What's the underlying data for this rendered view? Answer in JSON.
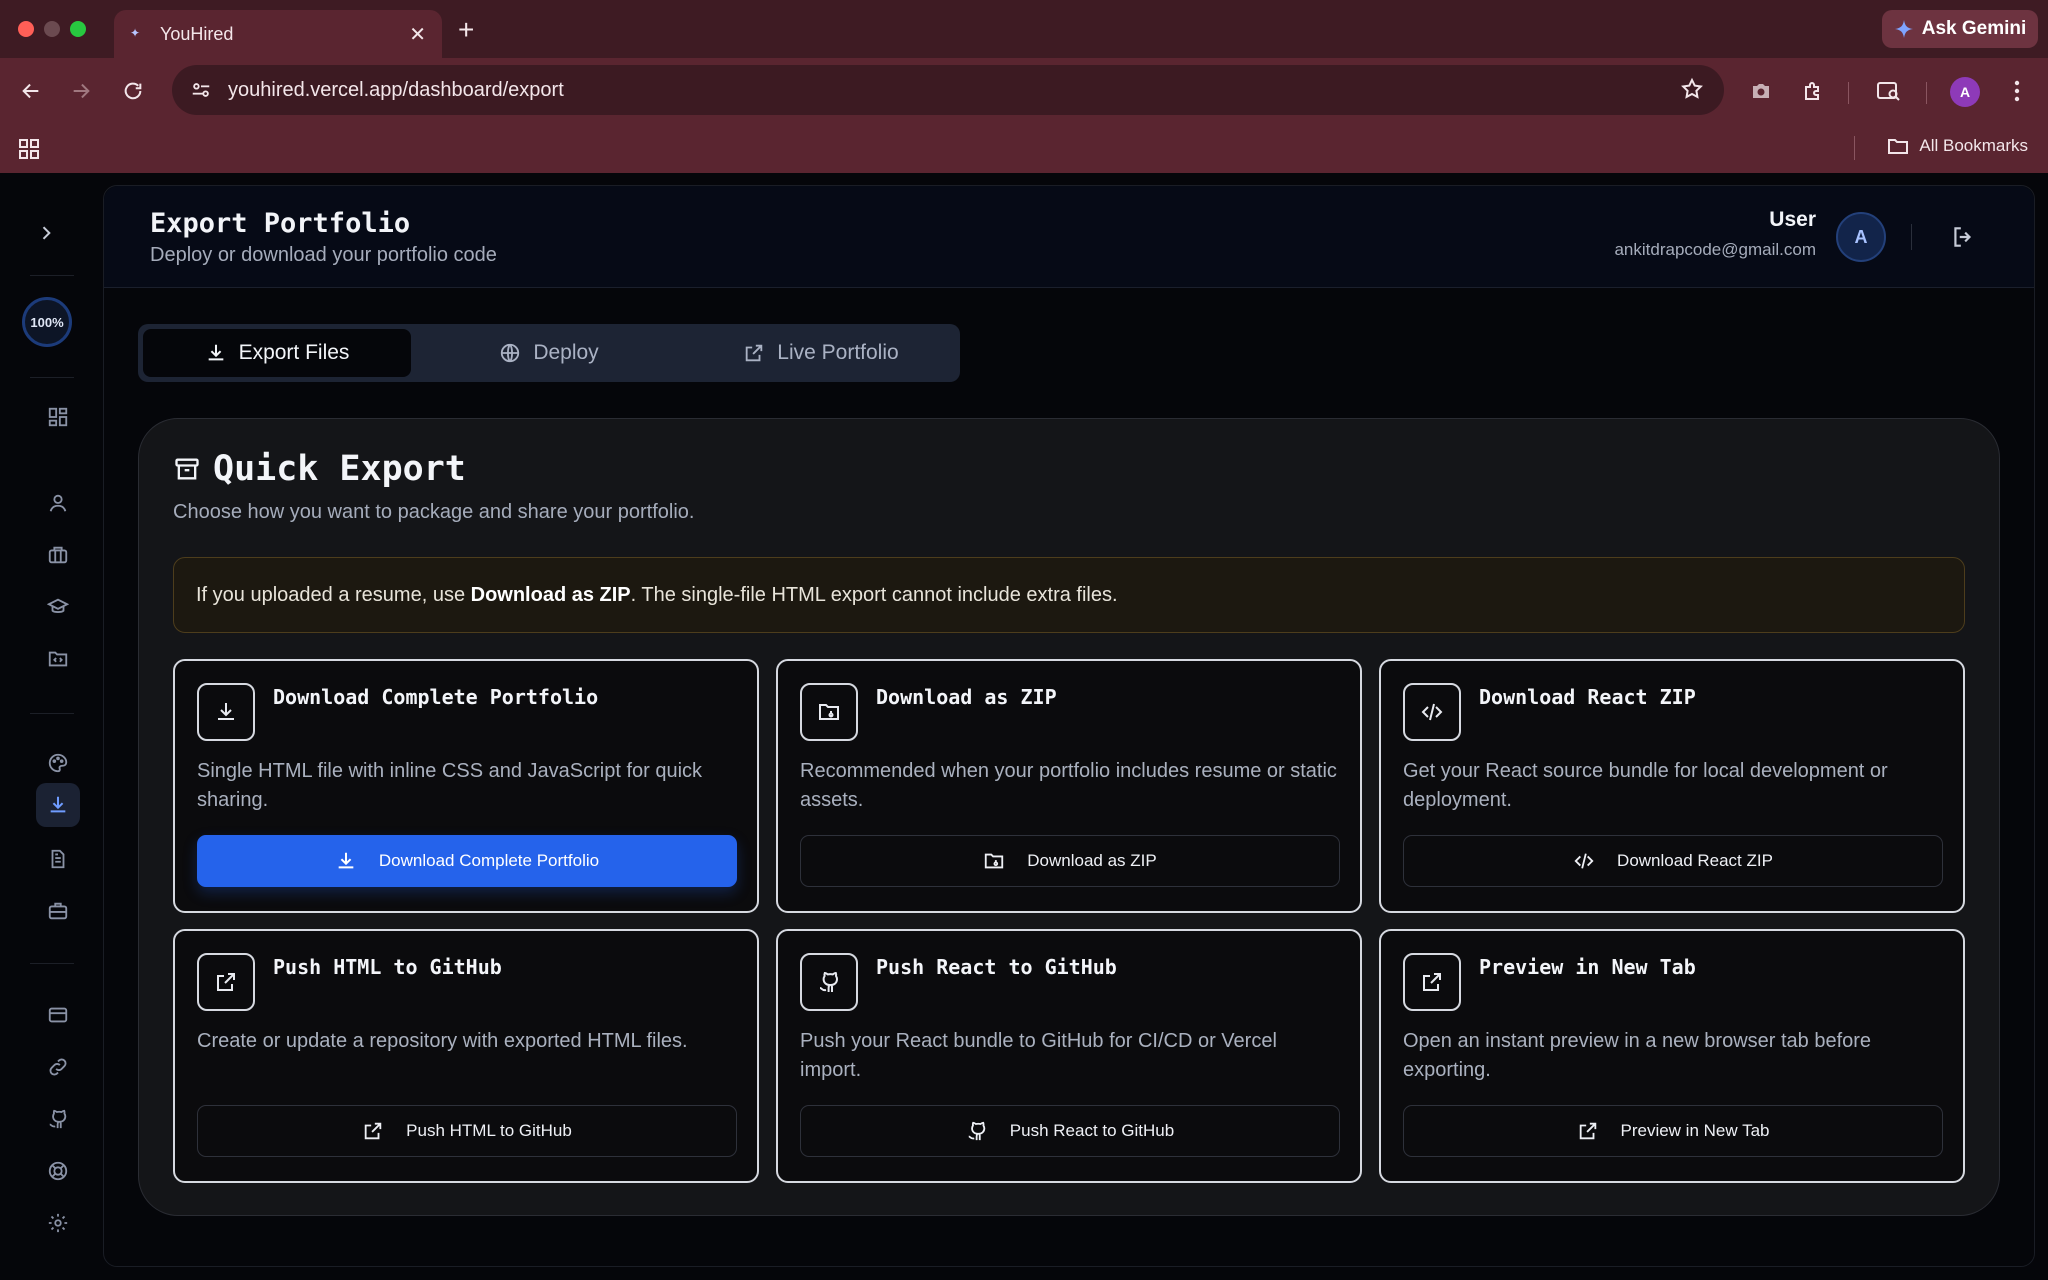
{
  "browser": {
    "tab_title": "YouHired",
    "url": "youhired.vercel.app/dashboard/export",
    "ask_gemini": "Ask Gemini",
    "profile_initial": "A",
    "all_bookmarks": "All Bookmarks"
  },
  "sidebar": {
    "progress": "100%"
  },
  "header": {
    "title": "Export Portfolio",
    "subtitle": "Deploy or download your portfolio code",
    "user_name": "User",
    "user_email": "ankitdrapcode@gmail.com",
    "avatar_initial": "A"
  },
  "tabs": [
    {
      "label": "Export Files"
    },
    {
      "label": "Deploy"
    },
    {
      "label": "Live Portfolio"
    }
  ],
  "quick_export": {
    "title": "Quick Export",
    "subtitle": "Choose how you want to package and share your portfolio.",
    "notice_pre": "If you uploaded a resume, use ",
    "notice_bold": "Download as ZIP",
    "notice_post": ". The single-file HTML export cannot include extra files."
  },
  "options": [
    {
      "title": "Download Complete Portfolio",
      "desc": "Single HTML file with inline CSS and JavaScript for quick sharing.",
      "button": "Download Complete Portfolio"
    },
    {
      "title": "Download as ZIP",
      "desc": "Recommended when your portfolio includes resume or static assets.",
      "button": "Download as ZIP"
    },
    {
      "title": "Download React ZIP",
      "desc": "Get your React source bundle for local development or deployment.",
      "button": "Download React ZIP"
    },
    {
      "title": "Push HTML to GitHub",
      "desc": "Create or update a repository with exported HTML files.",
      "button": "Push HTML to GitHub"
    },
    {
      "title": "Push React to GitHub",
      "desc": "Push your React bundle to GitHub for CI/CD or Vercel import.",
      "button": "Push React to GitHub"
    },
    {
      "title": "Preview in New Tab",
      "desc": "Open an instant preview in a new browser tab before exporting.",
      "button": "Preview in New Tab"
    }
  ],
  "colors": {
    "accent": "#2563eb",
    "chrome": "#5a2530",
    "background": "#05060a"
  }
}
